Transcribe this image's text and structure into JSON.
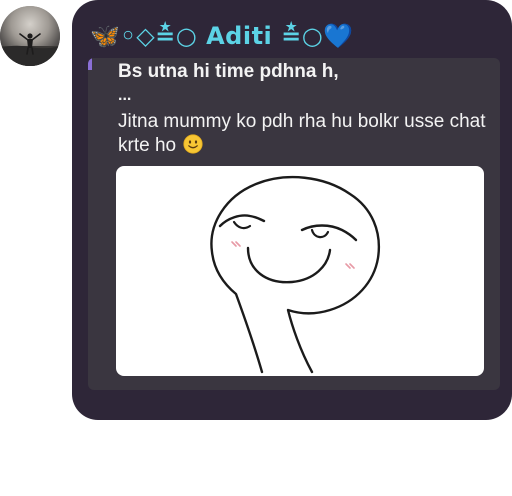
{
  "sender": {
    "name": "🦋◦◇≛○ Aditi ≛○💙"
  },
  "quoted_message": {
    "line1": "Bs utna hi time pdhna h,",
    "line2": "...",
    "line3": "Jitna mummy ko pdh rha hu bolkr usse chat",
    "line4": "krte ho"
  },
  "icons": {
    "avatar": "profile-photo",
    "emoji": "slightly-smiling-face",
    "sticker": "smirking-stick-face"
  },
  "colors": {
    "bubble": "#2e2638",
    "quote_bg": "#3a3640",
    "quote_accent": "#8a6fd6",
    "sender_name": "#5cd3e6"
  }
}
